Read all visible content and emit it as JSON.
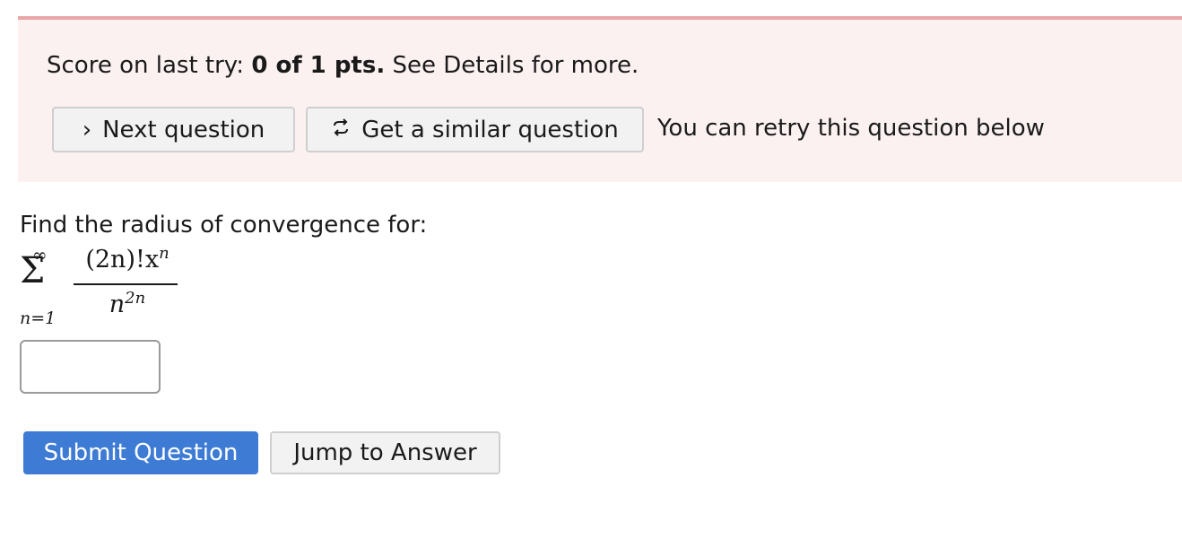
{
  "score": {
    "prefix": "Score on last try: ",
    "value": "0 of 1 pts.",
    "suffix": " See Details for more."
  },
  "actions": {
    "next_icon": "›",
    "next_label": "Next question",
    "similar_icon": "↻",
    "similar_label": "Get a similar question",
    "retry_note": "You can retry this question below"
  },
  "question": {
    "prompt": "Find the radius of convergence for:",
    "math": {
      "sum_upper": "∞",
      "sum_symbol": "Σ",
      "sum_lower": "n=1",
      "numerator_base": "(2n)!x",
      "numerator_exp": "n",
      "denominator_base": "n",
      "denominator_exp": "2n"
    },
    "answer_value": ""
  },
  "buttons": {
    "submit_label": "Submit Question",
    "jump_label": "Jump to Answer"
  },
  "colors": {
    "banner_bg": "#fcf1f1",
    "banner_border": "#eaa6a6",
    "primary": "#3d7bd4"
  }
}
